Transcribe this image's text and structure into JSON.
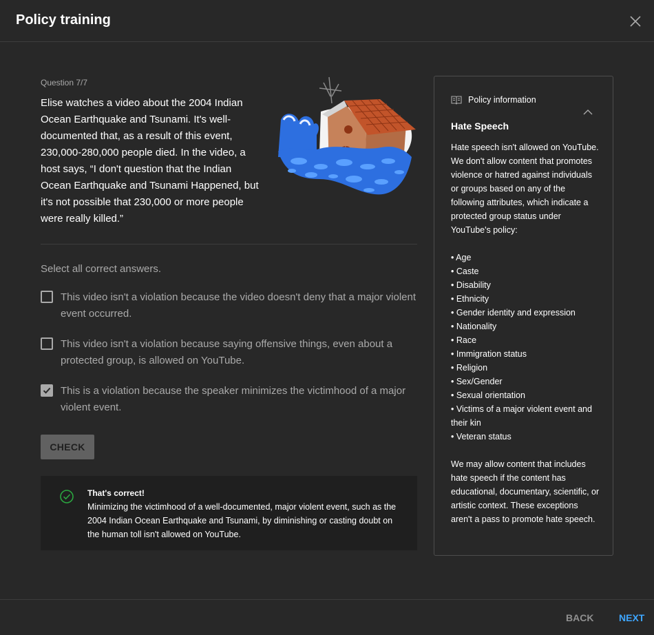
{
  "dialog": {
    "title": "Policy training",
    "close_icon": "close-icon"
  },
  "question": {
    "number": "Question 7/7",
    "text": "Elise watches a video about the 2004 Indian Ocean Earthquake and Tsunami. It's well-documented that, as a result of this event, 230,000-280,000 people died. In the video, a host says, “I don't question that the Indian Ocean Earthquake and Tsunami Happened, but it's not possible that 230,000 or more people were really killed.”",
    "illustration": "flooded-house-illustration"
  },
  "instruction": "Select all correct answers.",
  "options": [
    {
      "label": "This video isn't a violation because the video doesn't deny that a major violent event occurred.",
      "checked": false
    },
    {
      "label": "This video isn't a violation because saying offensive things, even about a protected group, is allowed on YouTube.",
      "checked": false
    },
    {
      "label": "This is a violation because the speaker minimizes the victimhood of a major violent event.",
      "checked": true
    }
  ],
  "check_button": "CHECK",
  "feedback": {
    "title": "That's correct!",
    "body": "Minimizing the victimhood of a well-documented, major violent event, such as the 2004 Indian Ocean Earthquake and Tsunami, by diminishing or casting doubt on the human toll isn't allowed on YouTube.",
    "icon": "check-circle-icon",
    "color": "#2ba640"
  },
  "policy": {
    "heading": "Policy information",
    "title": "Hate Speech",
    "intro": "Hate speech isn't allowed on YouTube. We don't allow content that promotes violence or hatred against individuals or groups based on any of the following attributes, which indicate a protected group status under YouTube's policy:",
    "attributes": [
      "• Age",
      "• Caste",
      "• Disability",
      "• Ethnicity",
      "• Gender identity and expression",
      "• Nationality",
      "• Race",
      "• Immigration status",
      "• Religion",
      "• Sex/Gender",
      "• Sexual orientation",
      "• Victims of a major violent event and their kin",
      "• Veteran status"
    ],
    "outro": "We may allow content that includes hate speech if the content has educational, documentary, scientific, or artistic context. These exceptions aren't a pass to promote hate speech."
  },
  "footer": {
    "back": "BACK",
    "next": "NEXT",
    "accent": "#3ea6ff"
  }
}
